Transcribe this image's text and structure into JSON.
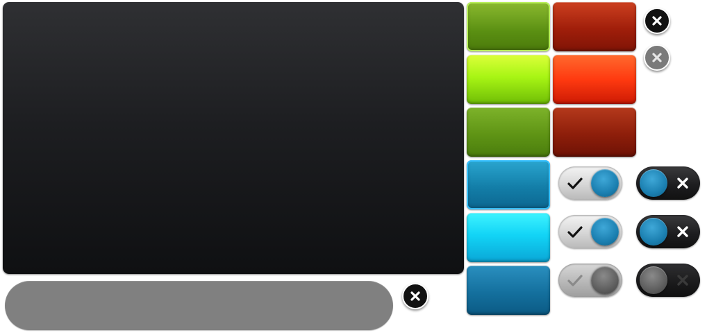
{
  "canvas": {
    "background": "#ffffff"
  },
  "preview_panel": {
    "gradient_top": "#2f3033",
    "gradient_bottom": "#0f1012"
  },
  "input_pill": {
    "value": "",
    "color": "#808080"
  },
  "close_buttons": [
    {
      "icon": "close-icon",
      "state": "normal",
      "color": "#111111"
    },
    {
      "icon": "close-icon",
      "state": "disabled",
      "color": "#7a7a7a"
    },
    {
      "icon": "close-icon",
      "state": "normal",
      "color": "#111111"
    }
  ],
  "swatches": {
    "green": [
      "#5a8f12",
      "#a8f514",
      "#5f9415"
    ],
    "red": [
      "#a01e0a",
      "#ff3a10",
      "#8e1e0a"
    ],
    "blue": [
      "#137ea8",
      "#12d4f6",
      "#14709e"
    ]
  },
  "toggles": {
    "light": [
      {
        "icon": "check-icon",
        "on": true
      },
      {
        "icon": "check-icon",
        "on": true
      },
      {
        "icon": "check-icon",
        "on": false
      }
    ],
    "dark": [
      {
        "icon": "x-icon",
        "on": true
      },
      {
        "icon": "x-icon",
        "on": true
      },
      {
        "icon": "x-icon",
        "on": false
      }
    ]
  }
}
